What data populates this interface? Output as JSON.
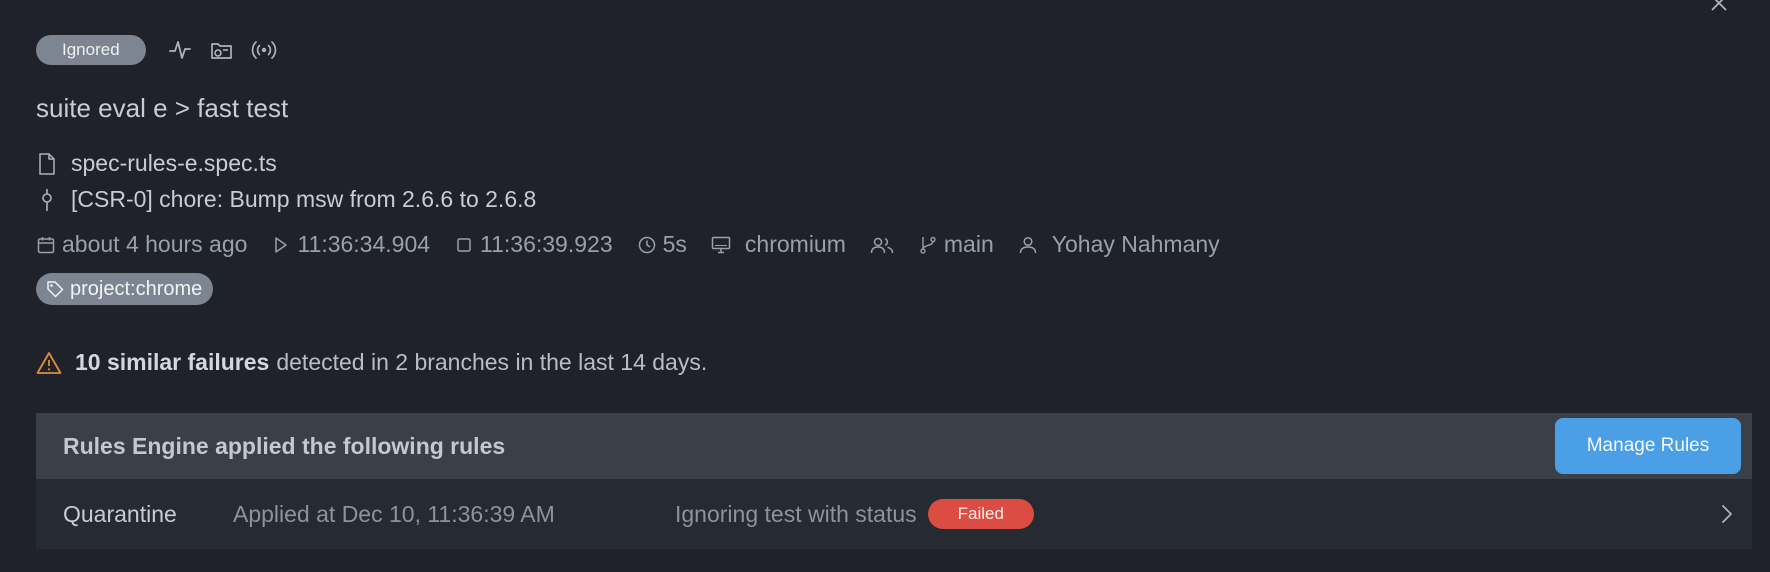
{
  "status_badge": "Ignored",
  "header_icons": [
    "activity-icon",
    "camera-folder-icon",
    "broadcast-icon",
    "close-icon"
  ],
  "test_title": "suite eval e > fast test",
  "file_name": "spec-rules-e.spec.ts",
  "commit_message": "[CSR-0] chore: Bump msw from 2.6.6 to 2.6.8",
  "meta": {
    "relative_time": "about 4 hours ago",
    "start_time": "11:36:34.904",
    "end_time": "11:36:39.923",
    "duration": "5s",
    "browser": "chromium",
    "branch": "main",
    "author": "Yohay Nahmany"
  },
  "tag": "project:chrome",
  "warning": {
    "highlight": "10 similar failures",
    "rest": "detected in 2 branches in the last 14 days.",
    "color": "#d9903a"
  },
  "rules_panel": {
    "header": "Rules Engine applied the following rules",
    "manage_button": "Manage Rules",
    "rows": [
      {
        "name": "Quarantine",
        "applied": "Applied at Dec 10, 11:36:39 AM",
        "description": "Ignoring test with status",
        "status": "Failed"
      }
    ]
  },
  "colors": {
    "background": "#1f222a",
    "pill_gray": "#7c8591",
    "accent_blue": "#4a9fe6",
    "failed_red": "#db4c42"
  }
}
